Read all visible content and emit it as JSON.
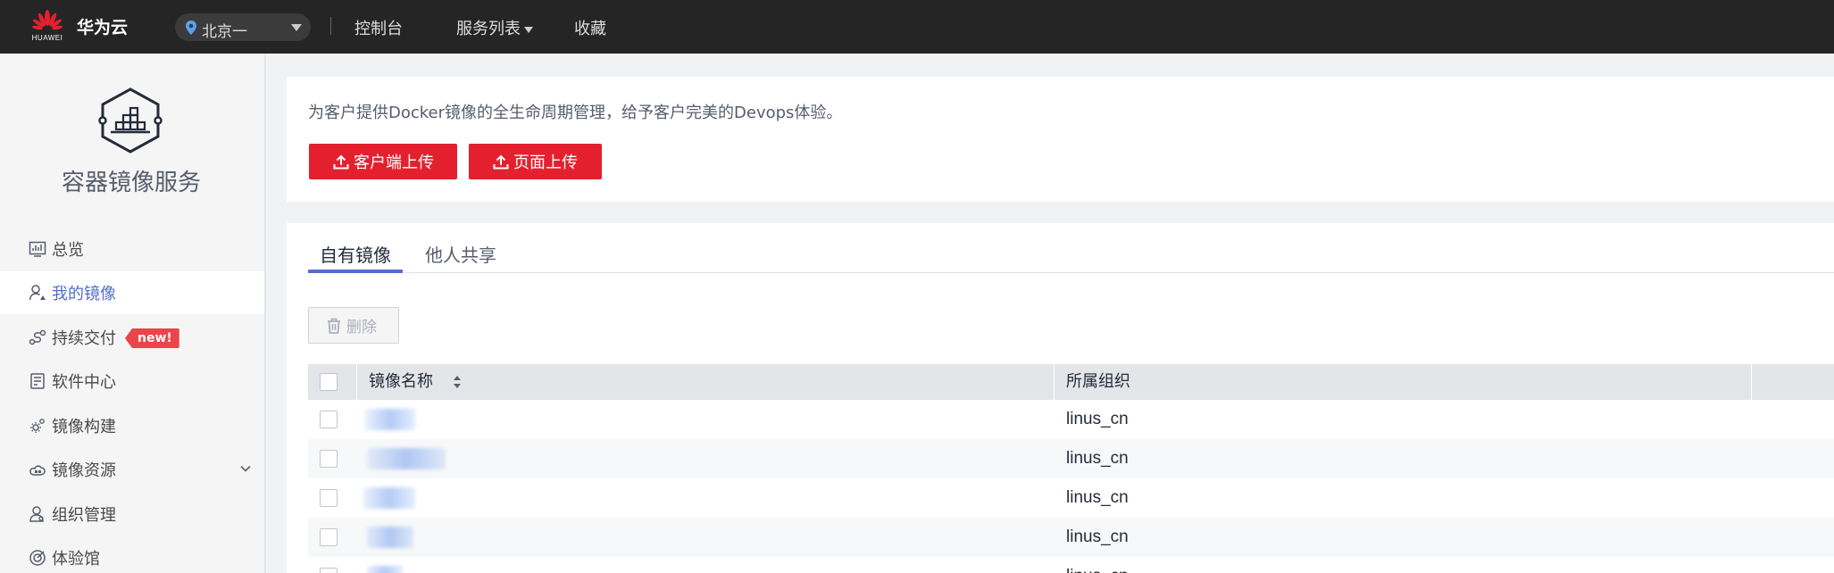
{
  "topbar": {
    "logo_text": "HUAWEI",
    "brand": "华为云",
    "region": "北京一",
    "nav": [
      {
        "label": "控制台"
      },
      {
        "label": "服务列表"
      },
      {
        "label": "收藏"
      }
    ],
    "colors": {
      "background": "#252525",
      "logo_red": "#e4202f"
    }
  },
  "sidebar": {
    "service_icon": "container-registry-icon",
    "service_name": "容器镜像服务",
    "items": [
      {
        "label": "总览",
        "icon": "dashboard-icon"
      },
      {
        "label": "我的镜像",
        "icon": "user-image-icon",
        "active": true
      },
      {
        "label": "持续交付",
        "icon": "pipeline-icon",
        "badge": "new!"
      },
      {
        "label": "软件中心",
        "icon": "software-center-icon"
      },
      {
        "label": "镜像构建",
        "icon": "build-gear-icon"
      },
      {
        "label": "镜像资源",
        "icon": "image-resource-icon",
        "expandable": true
      },
      {
        "label": "组织管理",
        "icon": "organization-icon"
      },
      {
        "label": "体验馆",
        "icon": "experience-icon"
      }
    ]
  },
  "intro": {
    "text": "为客户提供Docker镜像的全生命周期管理，给予客户完美的Devops体验。",
    "buttons": [
      {
        "label": "客户端上传",
        "icon": "upload-icon"
      },
      {
        "label": "页面上传",
        "icon": "upload-icon"
      }
    ]
  },
  "tabs": [
    {
      "label": "自有镜像",
      "active": true
    },
    {
      "label": "他人共享"
    }
  ],
  "toolbar": {
    "delete_label": "删除",
    "delete_icon": "trash-icon"
  },
  "table": {
    "columns": [
      "镜像名称",
      "所属组织"
    ],
    "rows": [
      {
        "name": "",
        "org": "linus_cn"
      },
      {
        "name": "",
        "org": "linus_cn"
      },
      {
        "name": "",
        "org": "linus_cn"
      },
      {
        "name": "",
        "org": "linus_cn"
      },
      {
        "name": "",
        "org": "linus_cn"
      }
    ]
  }
}
